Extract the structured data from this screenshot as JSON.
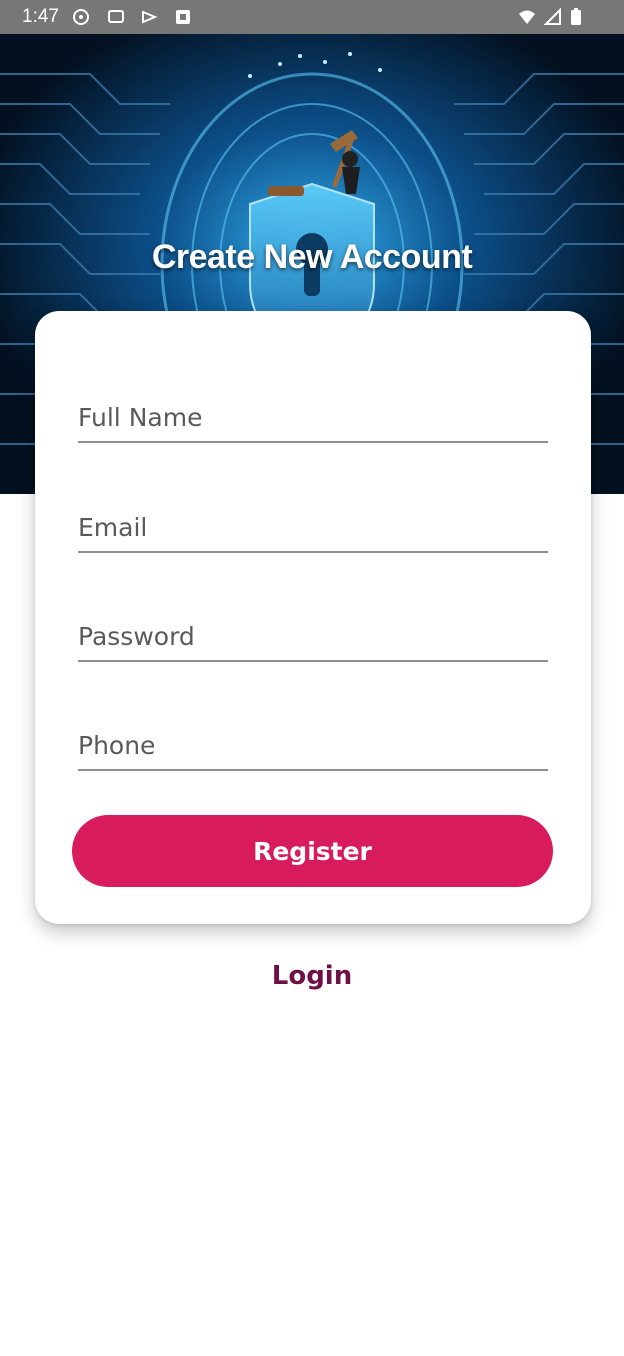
{
  "status_bar": {
    "time": "1:47",
    "icons": [
      "sync-icon",
      "message-icon",
      "cast-icon",
      "notification-box-icon",
      "wifi-icon",
      "signal-icon",
      "battery-icon"
    ]
  },
  "header": {
    "title": "Create New Account",
    "image": "cyber-security-shield-icon"
  },
  "form": {
    "full_name": {
      "value": "",
      "placeholder": "Full Name"
    },
    "email": {
      "value": "",
      "placeholder": "Email"
    },
    "password": {
      "value": "",
      "placeholder": "Password"
    },
    "phone": {
      "value": "",
      "placeholder": "Phone"
    },
    "register_label": "Register"
  },
  "login_label": "Login",
  "colors": {
    "accent": "#d81b5c",
    "login_text": "#6d1048",
    "status_bar": "#777777"
  }
}
